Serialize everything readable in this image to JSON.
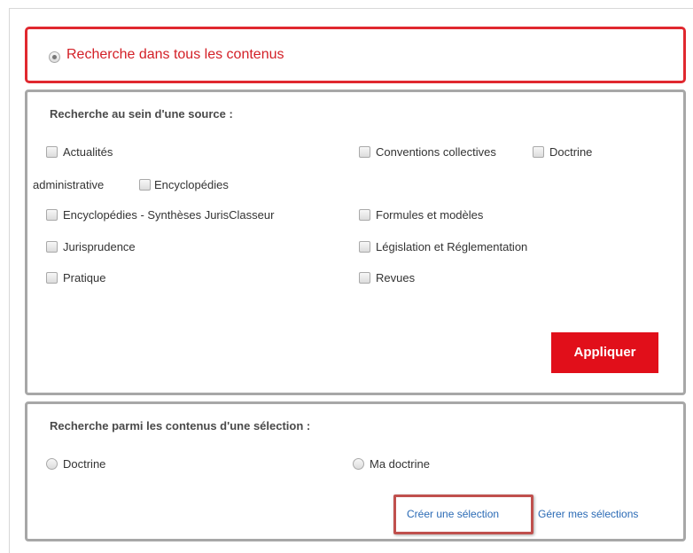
{
  "all_contents": {
    "label": "Recherche dans tous les contenus",
    "selected": true
  },
  "source_panel": {
    "title": "Recherche au sein d'une source :",
    "options": [
      "Actualités",
      "Conventions collectives",
      "Doctrine",
      "administrative",
      "Encyclopédies",
      "Encyclopédies - Synthèses JurisClasseur",
      "Formules et modèles",
      "Jurisprudence",
      "Législation et Réglementation",
      "Pratique",
      "Revues"
    ],
    "apply_label": "Appliquer"
  },
  "selection_panel": {
    "title": "Recherche parmi les contenus d'une sélection :",
    "options": [
      "Doctrine",
      "Ma doctrine"
    ],
    "create_link": "Créer une sélection",
    "manage_link": "Gérer mes sélections"
  },
  "colors": {
    "accent_red": "#e10f1a",
    "link_blue": "#2a6ab5",
    "highlight_border": "#c0504d"
  }
}
